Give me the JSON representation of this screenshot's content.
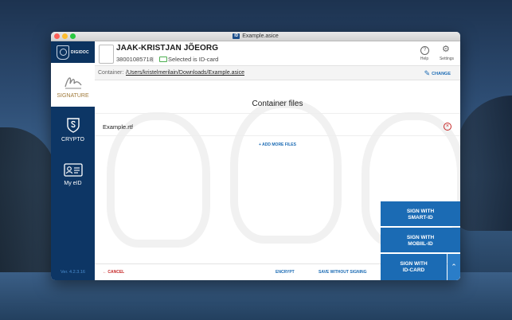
{
  "window": {
    "title": "Example.asice",
    "title_badge": "ID"
  },
  "sidebar": {
    "logo_text": "DIGIDOC",
    "items": [
      {
        "label": "SIGNATURE",
        "icon": "signature-icon",
        "active": true
      },
      {
        "label": "CRYPTO",
        "icon": "crypto-icon",
        "active": false
      },
      {
        "label": "My eID",
        "icon": "id-card-icon",
        "active": false
      }
    ],
    "version": "Ver. 4.2.3.16"
  },
  "header": {
    "name": "JAAK-KRISTJAN JÕEORG",
    "personal_code": "38001085718",
    "separator": "|",
    "selected_text": "Selected is ID-card",
    "help_label": "Help",
    "settings_label": "Settings"
  },
  "container": {
    "label": "Container:",
    "path": "/Users/kristelmerilain/Downloads/Example.asice",
    "change_label": "CHANGE"
  },
  "files": {
    "title": "Container files",
    "items": [
      "Example.rtf"
    ],
    "add_more_label": "+ ADD MORE FILES"
  },
  "footer": {
    "cancel_label": "← CANCEL",
    "encrypt_label": "ENCRYPT",
    "sign_without_label": "SAVE WITHOUT SIGNING"
  },
  "sign": {
    "smart_id": [
      "SIGN WITH",
      "SMART-ID"
    ],
    "mobiil_id": [
      "SIGN WITH",
      "MOBIIL-ID"
    ],
    "id_card": [
      "SIGN WITH",
      "ID-CARD"
    ],
    "expand_icon": "chevron-up-icon"
  },
  "colors": {
    "sidebar": "#0d3665",
    "accent": "#1b6bb4",
    "danger": "#c62828",
    "active_label": "#a07a3a"
  }
}
